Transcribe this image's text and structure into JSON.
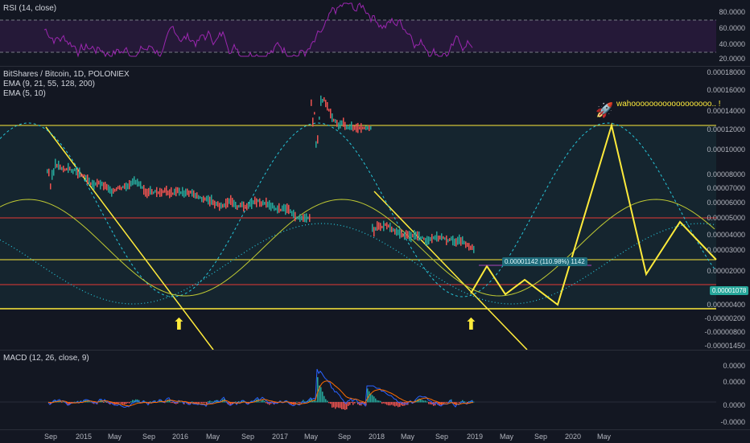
{
  "rsi": {
    "legend": "RSI (14, close)",
    "levels": [
      "80.0000",
      "60.0000",
      "40.0000",
      "20.0000"
    ],
    "color": "#9c27b0"
  },
  "main": {
    "legend_symbol": "BitShares / Bitcoin, 1D, POLONIEX",
    "legend_ema1": "EMA (9, 21, 55, 128, 200)",
    "legend_ema2": "EMA (5, 10)",
    "price_levels": [
      "0.00018000",
      "0.00016000",
      "0.00014000",
      "0.00012000",
      "0.00010000",
      "0.00008000",
      "0.00007000",
      "0.00006000",
      "0.00005000",
      "0.00004000",
      "0.00003000",
      "0.00002000",
      "0.00000400",
      "-0.00000200",
      "-0.00000800",
      "-0.00001450"
    ],
    "annotation": "wahoooooooooooooooooo.. !",
    "rocket": "🚀",
    "measure_label": "0.00001142 (110.98%) 1142",
    "last_price_tag": "0.00001078",
    "arrow_up": "⬆"
  },
  "macd": {
    "legend": "MACD (12, 26, close, 9)",
    "levels": [
      "0.0000",
      "0.0000",
      "0.0000",
      "-0.0000"
    ]
  },
  "time_axis": [
    "Sep",
    "2015",
    "May",
    "Sep",
    "2016",
    "May",
    "Sep",
    "2017",
    "May",
    "Sep",
    "2018",
    "May",
    "Sep",
    "2019",
    "May",
    "Sep",
    "2020",
    "May"
  ],
  "colors": {
    "background": "#131722",
    "yellow": "#ffeb3b",
    "red": "#e53935",
    "teal": "#26c6da",
    "rsi": "#9c27b0"
  }
}
